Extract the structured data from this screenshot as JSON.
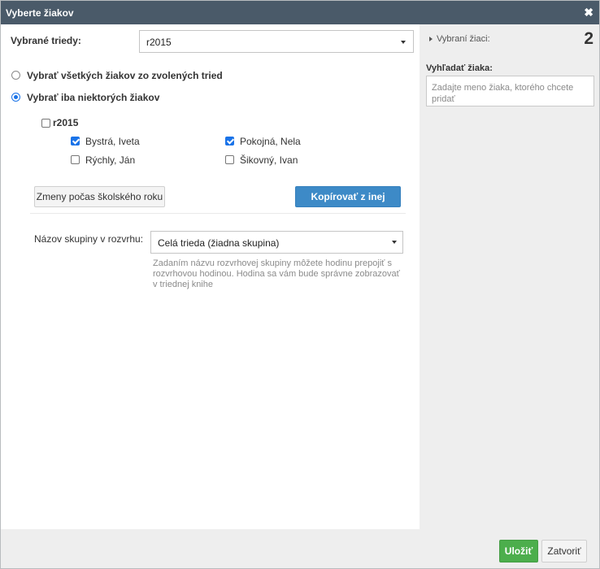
{
  "dialog": {
    "title": "Vyberte žiakov",
    "close_symbol": "✖"
  },
  "classes": {
    "label": "Vybrané triedy:",
    "selected_value": "r2015"
  },
  "mode": {
    "option_all_label": "Vybrať všetkých žiakov zo zvolených tried",
    "option_some_label": "Vybrať iba niektorých žiakov",
    "selected": "some"
  },
  "class_group": {
    "name": "r2015",
    "checked": false,
    "students": [
      {
        "name": "Bystrá, Iveta",
        "checked": true
      },
      {
        "name": "Pokojná, Nela",
        "checked": true
      },
      {
        "name": "Rýchly, Ján",
        "checked": false
      },
      {
        "name": "Šikovný, Ivan",
        "checked": false
      }
    ]
  },
  "actions": {
    "changes_button": "Zmeny počas školského roku",
    "copy_button": "Kopírovať z inej hodiny"
  },
  "schedule_group": {
    "label": "Názov skupiny v rozvrhu:",
    "selected_value": "Celá trieda (žiadna skupina)",
    "help_text": "Zadaním názvu rozvrhovej skupiny môžete hodinu prepojiť s rozvrhovou hodinou. Hodina sa vám bude správne zobrazovať v triednej knihe"
  },
  "sidebar": {
    "selected_students_label": "Vybraní žiaci:",
    "selected_count": "2",
    "search_label": "Vyhľadať žiaka:",
    "search_placeholder": "Zadajte meno žiaka, ktorého chcete pridať"
  },
  "footer": {
    "save_button": "Uložiť",
    "close_button": "Zatvoriť"
  },
  "colors": {
    "titlebar": "#4a5a69",
    "primary": "#3d8ac7",
    "success": "#4cae4c",
    "accent_check": "#1a73e8"
  }
}
